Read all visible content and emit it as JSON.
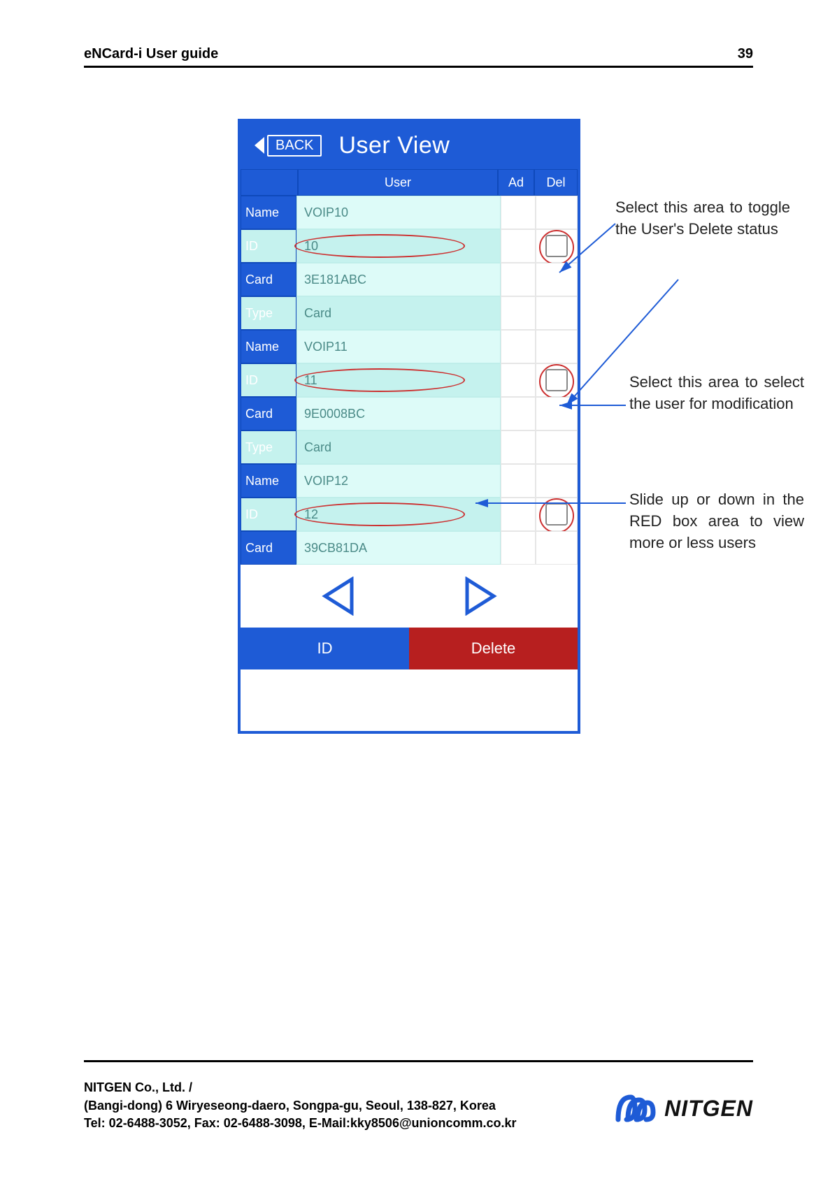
{
  "header": {
    "title": "eNCard-i User guide",
    "page_number": "39"
  },
  "phone": {
    "back_label": "BACK",
    "title": "User View",
    "columns": {
      "user": "User",
      "ad": "Ad",
      "del": "Del"
    },
    "field_labels": {
      "name": "Name",
      "id": "ID",
      "card": "Card",
      "type": "Type"
    },
    "users": [
      {
        "name": "VOIP10",
        "id": "10",
        "card": "3E181ABC",
        "type": "Card"
      },
      {
        "name": "VOIP11",
        "id": "11",
        "card": "9E0008BC",
        "type": "Card"
      },
      {
        "name": "VOIP12",
        "id": "12",
        "card": "39CB81DA"
      }
    ],
    "footer_buttons": {
      "id": "ID",
      "delete": "Delete"
    }
  },
  "annotations": {
    "a1": "Select this area to toggle the User's Delete status",
    "a2": "Select this area to select the user for modification",
    "a3": "Slide up or down in the RED box area to view more or less users"
  },
  "footer": {
    "line1": "NITGEN Co., Ltd. /",
    "line2": "(Bangi-dong) 6 Wiryeseong-daero, Songpa-gu, Seoul, 138-827, Korea",
    "line3": "Tel: 02-6488-3052, Fax: 02-6488-3098, E-Mail:kky8506@unioncomm.co.kr",
    "logo_text": "NITGEN"
  }
}
